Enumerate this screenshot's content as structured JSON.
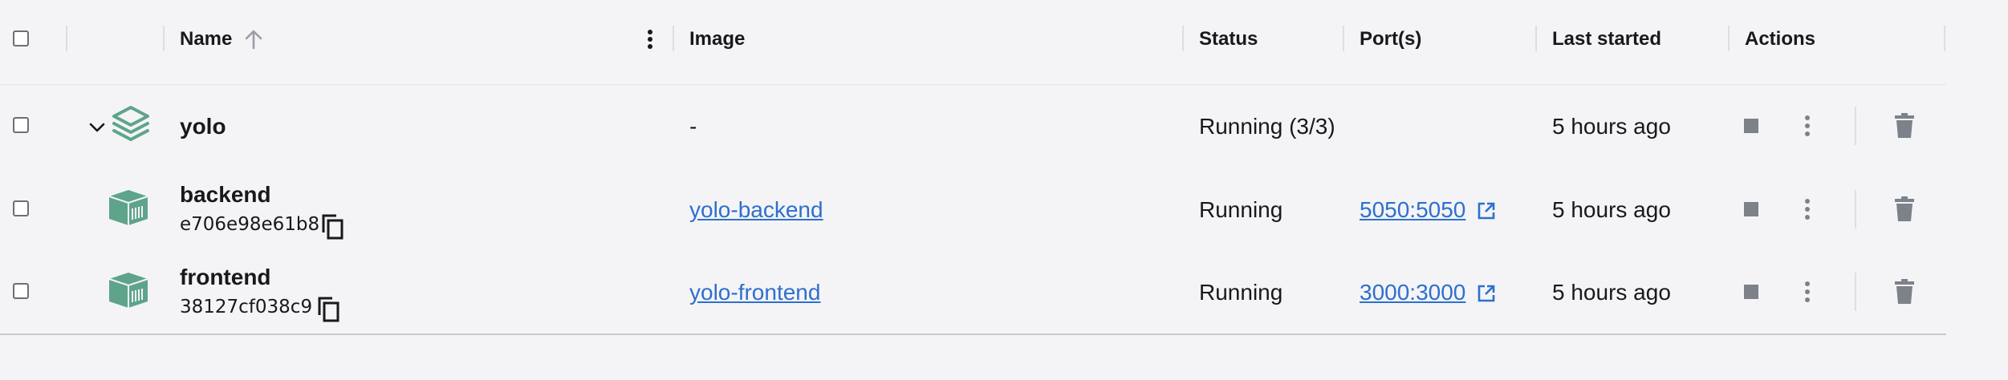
{
  "header": {
    "name": "Name",
    "image": "Image",
    "status": "Status",
    "ports": "Port(s)",
    "last_started": "Last started",
    "actions": "Actions"
  },
  "rows": [
    {
      "kind": "group",
      "name": "yolo",
      "image": "-",
      "status": "Running (3/3)",
      "port": "",
      "last_started": "5 hours ago"
    },
    {
      "kind": "container",
      "name": "backend",
      "id": "e706e98e61b8",
      "image": "yolo-backend",
      "status": "Running",
      "port": "5050:5050",
      "last_started": "5 hours ago"
    },
    {
      "kind": "container",
      "name": "frontend",
      "id": "38127cf038c9",
      "image": "yolo-frontend",
      "status": "Running",
      "port": "3000:3000",
      "last_started": "5 hours ago"
    }
  ],
  "colors": {
    "accent_link": "#2e6fcd",
    "container_icon": "#5ea48b",
    "action_icon": "#7d8189"
  },
  "icons": {
    "sort": "arrow-up-icon",
    "column_menu": "vertical-dots-icon",
    "group": "stack-icon",
    "container": "container-cube-icon",
    "copy": "copy-icon",
    "open_port": "external-link-icon",
    "stop": "stop-icon",
    "more": "vertical-dots-icon",
    "delete": "trash-icon"
  }
}
